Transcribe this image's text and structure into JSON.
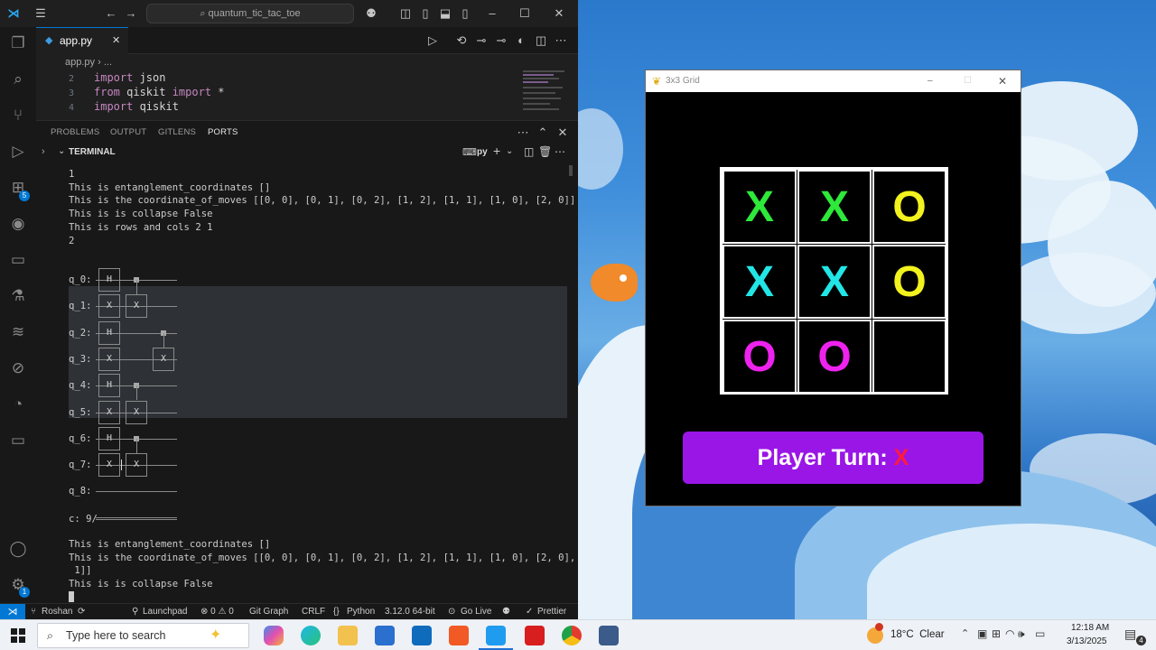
{
  "vscode": {
    "search_text": "quantum_tic_tac_toe",
    "tab_label": "app.py",
    "breadcrumb": [
      "app.py",
      "..."
    ],
    "code_lines": [
      {
        "num": "2",
        "parts": [
          [
            "kw",
            "import"
          ],
          [
            "id",
            " json"
          ]
        ]
      },
      {
        "num": "3",
        "parts": [
          [
            "kw",
            "from"
          ],
          [
            "id",
            " qiskit "
          ],
          [
            "kw",
            "import"
          ],
          [
            "id",
            " *"
          ]
        ]
      },
      {
        "num": "4",
        "parts": [
          [
            "kw",
            "import"
          ],
          [
            "id",
            " qiskit"
          ]
        ]
      }
    ],
    "panel_tabs": [
      "PROBLEMS",
      "OUTPUT",
      "GITLENS",
      "PORTS"
    ],
    "terminal_title": "TERMINAL",
    "terminal_shell": "py",
    "extensions_badge": "5",
    "accounts_badge": "1"
  },
  "terminal": {
    "lines_top": [
      "1",
      "This is entanglement_coordinates []",
      "This is the coordinate_of_moves [[0, 0], [0, 1], [0, 2], [1, 2], [1, 1], [1, 0], [2, 0]]",
      "This is is collapse False",
      "This is rows and cols 2 1",
      "2"
    ],
    "qubits": [
      "q_0:",
      "q_1:",
      "q_2:",
      "q_3:",
      "q_4:",
      "q_5:",
      "q_6:",
      "q_7:",
      "q_8:"
    ],
    "classical": "c: 9/",
    "gate_h": "H",
    "gate_x": "X",
    "lines_bottom": [
      "This is entanglement_coordinates []",
      "This is the coordinate_of_moves [[0, 0], [0, 1], [0, 2], [1, 2], [1, 1], [1, 0], [2, 0], [2,",
      " 1]]",
      "This is is collapse False"
    ]
  },
  "statusbar": {
    "user": "Roshan",
    "launchpad": "Launchpad",
    "problems": "⊗ 0 ⚠ 0",
    "git_graph": "Git Graph",
    "eol": "CRLF",
    "language": "Python",
    "python_version": "3.12.0 64-bit",
    "go_live": "Go Live",
    "prettier": "Prettier"
  },
  "game": {
    "window_title": "3x3 Grid",
    "board": [
      [
        {
          "mark": "X",
          "color": "#2ee83a"
        },
        {
          "mark": "X",
          "color": "#2ee83a"
        },
        {
          "mark": "O",
          "color": "#f2f21e"
        }
      ],
      [
        {
          "mark": "X",
          "color": "#22e6e6"
        },
        {
          "mark": "X",
          "color": "#22e6e6"
        },
        {
          "mark": "O",
          "color": "#f2f21e"
        }
      ],
      [
        {
          "mark": "O",
          "color": "#ee22ee"
        },
        {
          "mark": "O",
          "color": "#ee22ee"
        },
        {
          "mark": "",
          "color": "#ffffff"
        }
      ]
    ],
    "turn_label": "Player Turn:",
    "turn_player": "X",
    "turn_player_color": "#ff1a3c",
    "button_color": "#9a16e6"
  },
  "taskbar": {
    "search_placeholder": "Type here to search",
    "weather": "18°C  Clear",
    "time": "12:18 AM",
    "date": "3/13/2025",
    "notification_count": "4"
  }
}
